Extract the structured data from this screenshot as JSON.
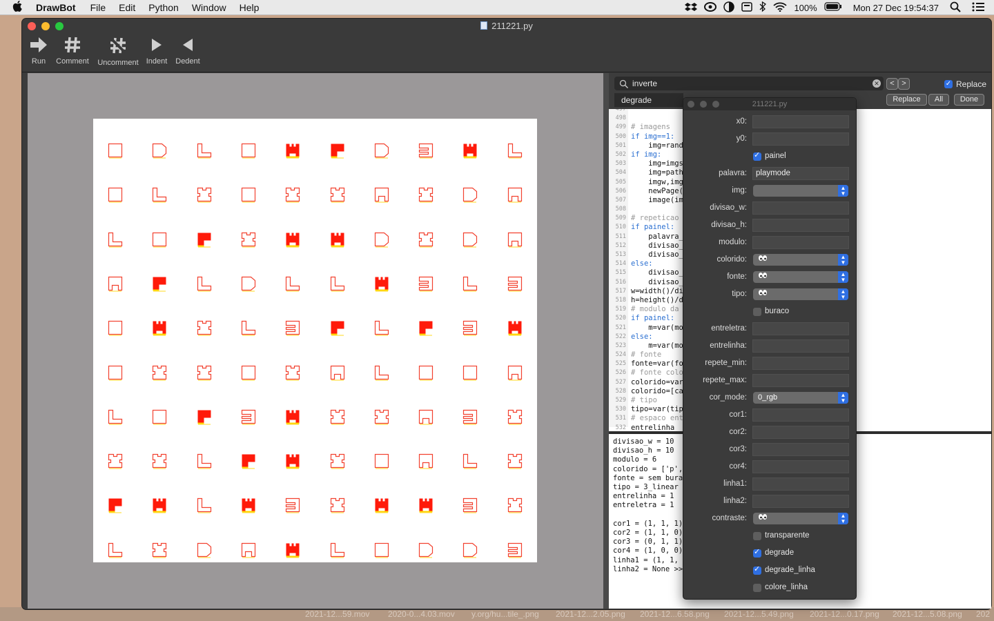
{
  "menubar": {
    "apple": "",
    "app": "DrawBot",
    "items": [
      "File",
      "Edit",
      "Python",
      "Window",
      "Help"
    ],
    "battery": "100%",
    "clock": "Mon 27 Dec  19:54:37"
  },
  "desktop_files": [
    "2021-12...59.mov",
    "2020-0...4.03.mov",
    "y.org/hu...tile_.png",
    "2021-12...2.05.png",
    "2021-12...6.58.png",
    "2021-12...5.49.png",
    "2021-12...0.17.png",
    "2021-12...5.08.png",
    "202"
  ],
  "window": {
    "title": "211221.py",
    "toolbar": [
      {
        "label": "Run",
        "icon": "run-arrow-icon"
      },
      {
        "label": "Comment",
        "icon": "hash-icon"
      },
      {
        "label": "Uncomment",
        "icon": "uncomment-hash-icon"
      },
      {
        "label": "Indent",
        "icon": "triangle-right-icon"
      },
      {
        "label": "Dedent",
        "icon": "triangle-left-icon"
      }
    ]
  },
  "find": {
    "search_value": "inverte",
    "replace_value": "degrade",
    "replace_checkbox": "Replace",
    "replace_button": "Replace",
    "all_button": "All",
    "done_button": "Done",
    "prev": "<",
    "next": ">"
  },
  "code": {
    "line_numbers": [
      "497",
      "498",
      "499",
      "500",
      "501",
      "502",
      "503",
      "504",
      "505",
      "506",
      "507",
      "508",
      "509",
      "510",
      "511",
      "512",
      "513",
      "514",
      "515",
      "516",
      "517",
      "518",
      "519",
      "520",
      "521",
      "522",
      "523",
      "524",
      "525",
      "526",
      "527",
      "528",
      "529",
      "530",
      "531",
      "532"
    ],
    "lines": [
      "",
      "",
      "# imagens",
      "if img==1:",
      "    img=rand",
      "if img:",
      "    img=imgs",
      "    img=path",
      "    imgw,img",
      "    newPage(",
      "    image(im",
      "",
      "# repeticao",
      "if painel:",
      "    palavra_",
      "    divisao_",
      "    divisao_",
      "else:",
      "    divisao_",
      "    divisao_",
      "w=width()/di",
      "h=height()/d",
      "# modulo da",
      "if painel:",
      "    m=var(mo",
      "else:",
      "    m=var(mo",
      "# fonte",
      "fonte=var(fo",
      "# fonte colo",
      "colorido=var",
      "colorido=[ca",
      "# tipo",
      "tipo=var(tip",
      "# espaco ent",
      "entrelinha"
    ]
  },
  "output": {
    "lines": [
      "divisao_w = 10",
      "divisao_h = 10",
      "modulo = 6",
      "colorido = ['p',",
      "fonte = sem burac",
      "tipo = 3_linear",
      "entrelinha = 1",
      "entreletra = 1",
      "",
      "cor1 = (1, 1, 1)",
      "cor2 = (1, 1, 0)",
      "cor3 = (0, 1, 1)",
      "cor4 = (1, 0, 0)",
      "linha1 = (1, 1, 0",
      "linha2 = None >>>"
    ]
  },
  "variables_panel": {
    "title": "211221.py",
    "rows": [
      {
        "label": "x0:",
        "kind": "field",
        "value": ""
      },
      {
        "label": "y0:",
        "kind": "field",
        "value": ""
      },
      {
        "label": "painel",
        "kind": "check",
        "checked": true
      },
      {
        "label": "palavra:",
        "kind": "field",
        "value": "playmode"
      },
      {
        "label": "img:",
        "kind": "popup",
        "value": ""
      },
      {
        "label": "divisao_w:",
        "kind": "field",
        "value": ""
      },
      {
        "label": "divisao_h:",
        "kind": "field",
        "value": ""
      },
      {
        "label": "modulo:",
        "kind": "field",
        "value": ""
      },
      {
        "label": "colorido:",
        "kind": "popup",
        "value": "👀"
      },
      {
        "label": "fonte:",
        "kind": "popup",
        "value": "👀"
      },
      {
        "label": "tipo:",
        "kind": "popup",
        "value": "👀"
      },
      {
        "label": "buraco",
        "kind": "check",
        "checked": false
      },
      {
        "label": "entreletra:",
        "kind": "field",
        "value": ""
      },
      {
        "label": "entrelinha:",
        "kind": "field",
        "value": ""
      },
      {
        "label": "repete_min:",
        "kind": "field",
        "value": ""
      },
      {
        "label": "repete_max:",
        "kind": "field",
        "value": ""
      },
      {
        "label": "cor_mode:",
        "kind": "popup",
        "value": "0_rgb"
      },
      {
        "label": "cor1:",
        "kind": "field",
        "value": ""
      },
      {
        "label": "cor2:",
        "kind": "field",
        "value": ""
      },
      {
        "label": "cor3:",
        "kind": "field",
        "value": ""
      },
      {
        "label": "cor4:",
        "kind": "field",
        "value": ""
      },
      {
        "label": "linha1:",
        "kind": "field",
        "value": ""
      },
      {
        "label": "linha2:",
        "kind": "field",
        "value": ""
      },
      {
        "label": "contraste:",
        "kind": "popup",
        "value": "👀"
      },
      {
        "label": "transparente",
        "kind": "check",
        "checked": false
      },
      {
        "label": "degrade",
        "kind": "check",
        "checked": true
      },
      {
        "label": "degrade_linha",
        "kind": "check",
        "checked": true
      },
      {
        "label": "colore_linha",
        "kind": "check",
        "checked": false
      }
    ]
  },
  "canvas": {
    "colors": {
      "stroke": "#f2412f",
      "fill": "#ff1a0a",
      "shadow": "#ffd400"
    },
    "grid": [
      [
        "sq",
        "tab",
        "L",
        "sq",
        "castle",
        "fillflag",
        "tab",
        "E",
        "castle",
        "L"
      ],
      [
        "sq",
        "L",
        "cross",
        "sq",
        "cross",
        "cross",
        "notch",
        "cross",
        "tab",
        "notch"
      ],
      [
        "L",
        "sq",
        "fillflag",
        "cross",
        "castle",
        "castle",
        "tab",
        "cross",
        "tab",
        "notch"
      ],
      [
        "notch",
        "fillflag",
        "L",
        "tab",
        "L",
        "L",
        "castle",
        "E",
        "L",
        "E"
      ],
      [
        "sq",
        "castle",
        "cross",
        "L",
        "E",
        "fillflag",
        "L",
        "fillflag",
        "E",
        "castle"
      ],
      [
        "sq",
        "cross",
        "cross",
        "sq",
        "cross",
        "notch",
        "L",
        "sq",
        "sq",
        "notch"
      ],
      [
        "L",
        "sq",
        "fillflag",
        "E",
        "castle",
        "cross",
        "cross",
        "notch",
        "E",
        "cross"
      ],
      [
        "cross",
        "cross",
        "L",
        "fillflag",
        "castle",
        "cross",
        "sq",
        "notch",
        "L",
        "cross"
      ],
      [
        "fillflag",
        "castle",
        "L",
        "castle",
        "E",
        "cross",
        "castle",
        "castle",
        "E",
        "cross"
      ],
      [
        "L",
        "cross",
        "tab",
        "notch",
        "castle",
        "L",
        "sq",
        "tab",
        "tab",
        "E"
      ]
    ]
  }
}
